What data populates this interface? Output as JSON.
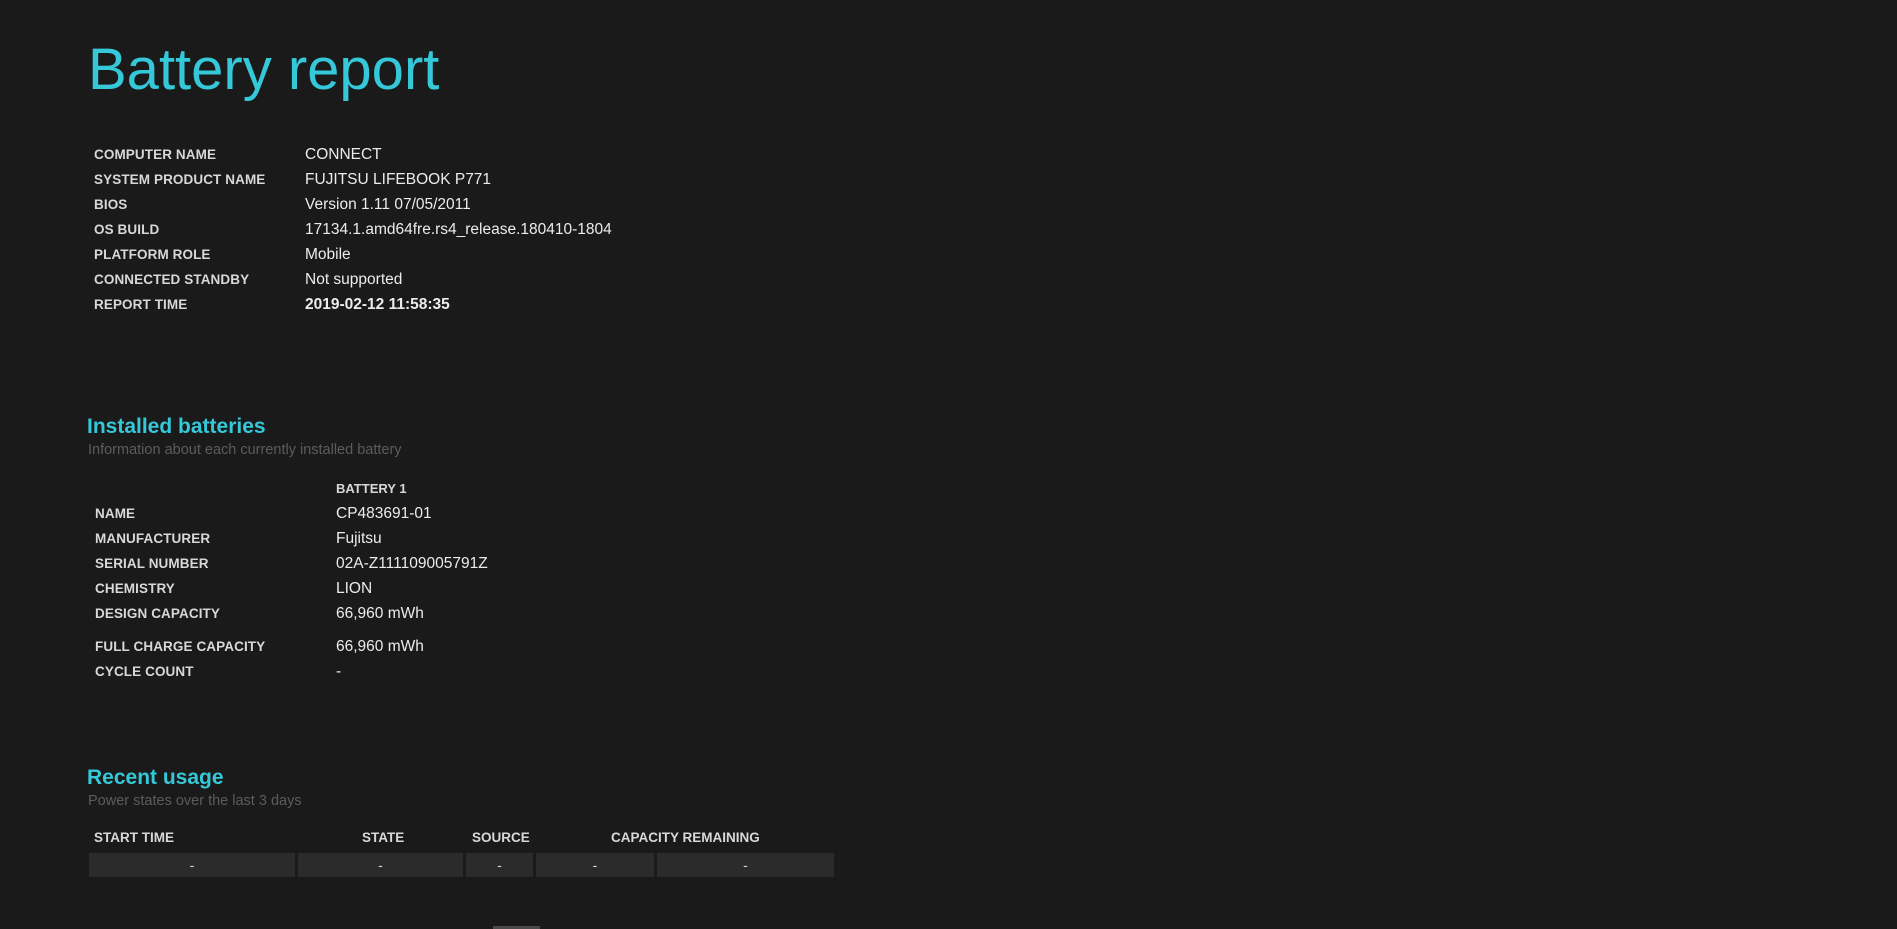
{
  "report": {
    "title": "Battery report",
    "info": [
      {
        "label": "COMPUTER NAME",
        "value": "CONNECT"
      },
      {
        "label": "SYSTEM PRODUCT NAME",
        "value": "FUJITSU LIFEBOOK P771"
      },
      {
        "label": "BIOS",
        "value": "Version 1.11 07/05/2011"
      },
      {
        "label": "OS BUILD",
        "value": "17134.1.amd64fre.rs4_release.180410-1804"
      },
      {
        "label": "PLATFORM ROLE",
        "value": "Mobile"
      },
      {
        "label": "CONNECTED STANDBY",
        "value": "Not supported"
      },
      {
        "label": "REPORT TIME",
        "value": "2019-02-12  11:58:35"
      }
    ]
  },
  "installed_batteries": {
    "title": "Installed batteries",
    "subtitle": "Information about each currently installed battery",
    "column_header": "BATTERY 1",
    "rows": [
      {
        "label": "NAME",
        "value": "CP483691-01"
      },
      {
        "label": "MANUFACTURER",
        "value": "Fujitsu"
      },
      {
        "label": "SERIAL NUMBER",
        "value": "02A-Z111109005791Z"
      },
      {
        "label": "CHEMISTRY",
        "value": "LION"
      },
      {
        "label": "DESIGN CAPACITY",
        "value": "66,960 mWh"
      },
      {
        "label": "FULL CHARGE CAPACITY",
        "value": "66,960 mWh"
      },
      {
        "label": "CYCLE COUNT",
        "value": "-"
      }
    ]
  },
  "recent_usage": {
    "title": "Recent usage",
    "subtitle": "Power states over the last 3 days",
    "headers": [
      "START TIME",
      "STATE",
      "SOURCE",
      "CAPACITY REMAINING"
    ],
    "row": [
      "-",
      "-",
      "-",
      "-",
      "-"
    ]
  }
}
